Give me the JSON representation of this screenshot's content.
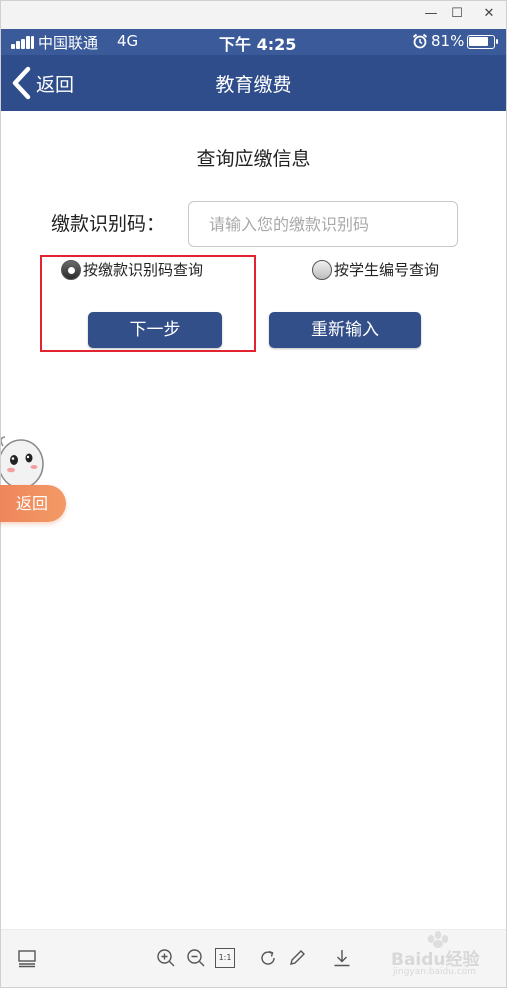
{
  "window": {
    "minimize": "—",
    "maximize": "☐",
    "close": "✕"
  },
  "status_bar": {
    "carrier": "中国联通",
    "network": "4G",
    "time": "下午 4:25",
    "battery": "81%",
    "battery_level": 0.81,
    "icons": [
      "signal-icon",
      "alarm-icon",
      "battery-icon"
    ]
  },
  "header": {
    "back_label": "返回",
    "title": "教育缴费"
  },
  "form": {
    "title": "查询应缴信息",
    "code_label": "缴款识别码：",
    "code_placeholder": "请输入您的缴款识别码",
    "code_value": "",
    "radio_by_code": "按缴款识别码查询",
    "radio_by_student": "按学生编号查询",
    "selected": "by_code",
    "next_button": "下一步",
    "reset_button": "重新输入"
  },
  "float": {
    "back_label": "返回"
  },
  "toolbar": {
    "icons": [
      "layout-icon",
      "zoom-in-icon",
      "zoom-out-icon",
      "actual-size-icon",
      "rotate-icon",
      "edit-icon",
      "download-icon"
    ],
    "actual_size_label": "1:1"
  },
  "watermark": {
    "brand": "Baidu经验",
    "url": "jingyan.baidu.com"
  },
  "colors": {
    "header": "#2e4d8a",
    "status": "#3a5a9a",
    "button": "#334f89",
    "highlight": "#e3232f",
    "float": "#ee8058"
  }
}
